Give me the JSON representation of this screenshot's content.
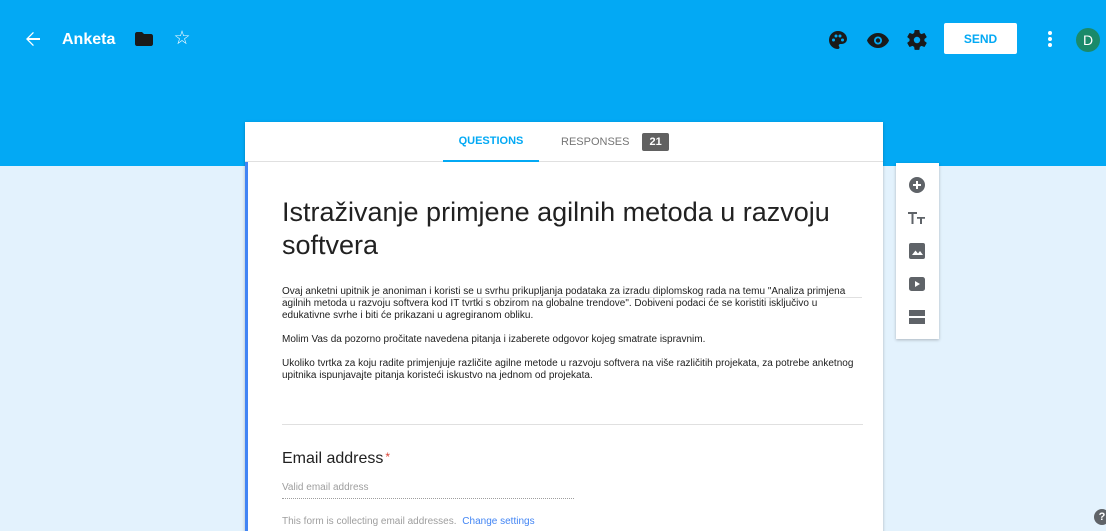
{
  "header": {
    "form_name": "Anketa",
    "send_label": "SEND",
    "avatar_initial": "D",
    "icons": [
      "arrow-back-icon",
      "folder-icon",
      "star-outline-icon",
      "palette-icon",
      "eye-icon",
      "gear-icon",
      "more-vert-icon"
    ]
  },
  "tabs": {
    "questions": "QUESTIONS",
    "responses": "RESPONSES",
    "responses_count": "21"
  },
  "form": {
    "title": "Istraživanje primjene agilnih metoda u razvoju softvera",
    "description": [
      "Ovaj anketni upitnik je anoniman i koristi se u svrhu prikupljanja podataka za izradu diplomskog rada na temu \"Analiza primjena agilnih metoda u razvoju softvera kod IT tvrtki s obzirom na globalne trendove\". Dobiveni podaci će se koristiti isključivo u edukativne svrhe i biti će prikazani u agregiranom obliku.",
      "Molim Vas da pozorno pročitate navedena pitanja i izaberete odgovor kojeg smatrate ispravnim.",
      "Ukoliko tvrtka za koju radite primjenjuje različite agilne metode u razvoju softvera na više različitih projekata, za potrebe anketnog upitnika ispunjavajte pitanja koristeći iskustvo na jednom od projekata."
    ],
    "email_question": {
      "label": "Email address",
      "required_mark": "*",
      "placeholder": "Valid email address",
      "collect_note": "This form is collecting email addresses.",
      "change_link": "Change settings"
    }
  },
  "toolbox": [
    "add-circle-icon",
    "title-text-icon",
    "image-icon",
    "video-icon",
    "section-icon"
  ],
  "help_label": "?",
  "colors": {
    "header_blue": "#03a9f4",
    "background": "#e3f2fd",
    "accent_border": "#4285f4",
    "required_red": "#db4437"
  }
}
